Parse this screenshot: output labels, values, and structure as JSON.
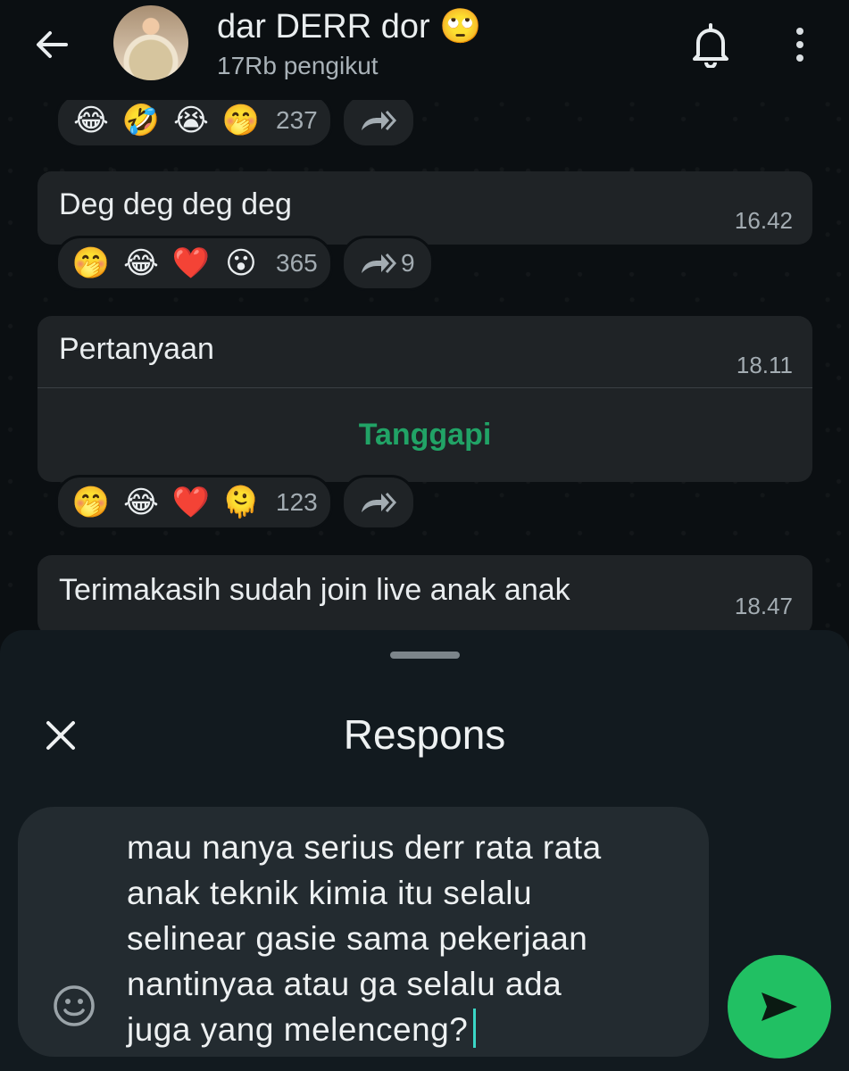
{
  "header": {
    "back_icon": "arrow-left-icon",
    "channel_name": "dar DERR dor 🙄",
    "followers": "17Rb pengikut",
    "bell_icon": "bell-icon",
    "menu_icon": "more-vertical-icon"
  },
  "messages": [
    {
      "reactions": [
        "😂",
        "🤣",
        "😭",
        "🤭"
      ],
      "reaction_count": "237",
      "forward_count": ""
    },
    {
      "text": "Deg deg deg deg",
      "time": "16.42",
      "reactions": [
        "🤭",
        "😂",
        "❤️",
        "😮"
      ],
      "reaction_count": "365",
      "forward_count": "9"
    },
    {
      "text": "Pertanyaan",
      "time": "18.11",
      "action": "Tanggapi",
      "reactions": [
        "🤭",
        "😂",
        "❤️",
        "🫠"
      ],
      "reaction_count": "123",
      "forward_count": ""
    },
    {
      "text": "Terimakasih sudah join live anak anak",
      "time": "18.47"
    }
  ],
  "sheet": {
    "title": "Respons",
    "close_icon": "close-icon",
    "input_value": "mau nanya serius derr rata rata\nanak teknik kimia itu selalu\nselinear gasie sama pekerjaan\nnantinyaa atau ga selalu ada\njuga yang melenceng?",
    "emoji_icon": "smiley-icon",
    "send_icon": "send-icon"
  },
  "colors": {
    "accent_green": "#21C063",
    "action_green": "#21A366",
    "bubble": "#1F2326",
    "background": "#0B0F12"
  }
}
